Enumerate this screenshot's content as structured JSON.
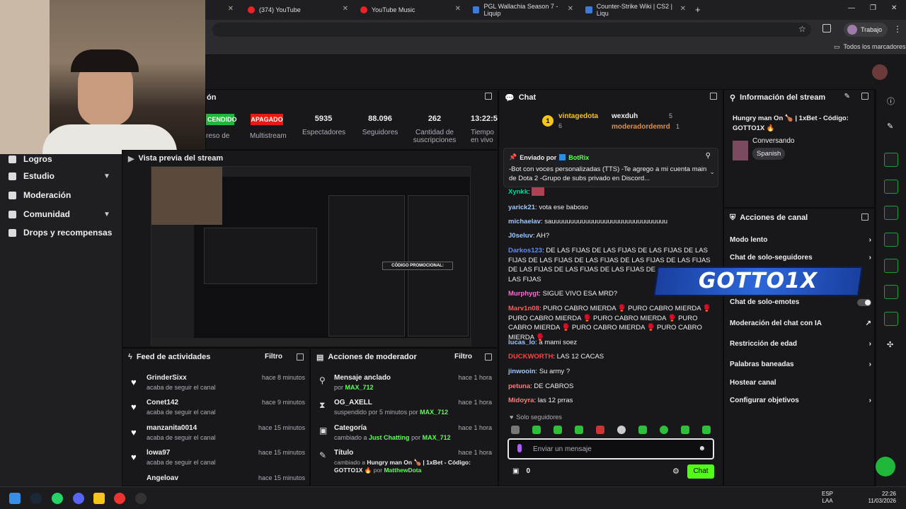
{
  "browser": {
    "tabs": [
      {
        "label": "(374) YouTube"
      },
      {
        "label": "YouTube Music"
      },
      {
        "label": "PGL Wallachia Season 7 - Liquip"
      },
      {
        "label": "Counter-Strike Wiki | CS2 | Liqu"
      }
    ],
    "profile_label": "Trabajo",
    "bookmarks_label": "Todos los marcadores"
  },
  "status": {
    "title_partial": "ón",
    "stats": [
      {
        "value": "CENDIDO",
        "label": "reso de"
      },
      {
        "value": "APAGADO",
        "label": "Multistream"
      },
      {
        "value": "5935",
        "label": "Espectadores"
      },
      {
        "value": "88.096",
        "label": "Seguidores"
      },
      {
        "value": "262",
        "label": "Cantidad de suscripciones"
      },
      {
        "value": "13:22:5",
        "label": "Tiempo en vivo"
      }
    ]
  },
  "sidebar": {
    "items": [
      {
        "label": "Logros"
      },
      {
        "label": "Estudio"
      },
      {
        "label": "Moderación"
      },
      {
        "label": "Comunidad"
      },
      {
        "label": "Drops y recompensas"
      }
    ]
  },
  "preview": {
    "title": "Vista previa del stream",
    "promo": "CÓDIGO PROMOCIONAL:"
  },
  "feed": {
    "title": "Feed de actividades",
    "filter": "Filtro",
    "items": [
      {
        "name": "GrinderSixx",
        "sub": "acaba de seguir el canal",
        "time": "hace 8 minutos"
      },
      {
        "name": "Conet142",
        "sub": "acaba de seguir el canal",
        "time": "hace 9 minutos"
      },
      {
        "name": "manzanita0014",
        "sub": "acaba de seguir el canal",
        "time": "hace 15 minutos"
      },
      {
        "name": "lowa97",
        "sub": "acaba de seguir el canal",
        "time": "hace 15 minutos"
      },
      {
        "name": "Angeloav",
        "sub": "",
        "time": "hace 15 minutos"
      }
    ]
  },
  "modactions": {
    "title": "Acciones de moderador",
    "filter": "Filtro",
    "items": [
      {
        "title": "Mensaje anclado",
        "pre": "por",
        "who": "MAX_712",
        "time": "hace 1 hora"
      },
      {
        "title": "OG_AXELL",
        "pre": "suspendido por 5 minutos por",
        "who": "MAX_712",
        "time": "hace 1 hora"
      },
      {
        "title": "Categoría",
        "pre": "cambiado a",
        "extra": "Just Chatting",
        "mid": "por",
        "who": "MAX_712",
        "time": "hace 1 hora"
      },
      {
        "title": "Título",
        "pre": "cambiado a",
        "extra": "Hungry man On 🍗 | 1xBet - Código: GOTTO1X 🔥",
        "mid": "por",
        "who": "MatthewDota",
        "time": "hace 1 hora"
      }
    ]
  },
  "chat": {
    "title": "Chat",
    "top": [
      {
        "rank": "1",
        "name": "vintagedota",
        "count": "6"
      },
      {
        "name": "wexduh",
        "count": "5"
      },
      {
        "name": "moderadordemrd",
        "count": "1"
      }
    ],
    "pinned": {
      "by_label": "Enviado por",
      "by": "BotRix",
      "text": "-Bot con voces personalizadas (TTS) -Te agrego a mi cuenta main de Dota 2 -Grupo de subs privado en Discord..."
    },
    "messages": [
      {
        "user": "Xynkk",
        "color": "#00d3a0",
        "text": ""
      },
      {
        "user": "yarick21",
        "color": "#9ec7ff",
        "text": "vota ese baboso"
      },
      {
        "user": "michaelav",
        "color": "#9ec7ff",
        "text": "sauuuuuuuuuuuuuuuuuuuuuuuuuuuuuuu"
      },
      {
        "user": "J0seluv",
        "color": "#9ec7ff",
        "text": "AH?"
      },
      {
        "user": "Darkos123",
        "color": "#5b8cff",
        "text": "DE LAS FIJAS DE LAS FIJAS DE LAS FIJAS DE LAS FIJAS DE LAS FIJAS DE LAS FIJAS DE LAS FIJAS DE LAS FIJAS DE LAS FIJAS DE LAS FIJAS DE LAS FIJAS DE LAS FIJAS DE LAS FIJAS"
      },
      {
        "user": "Murphygt",
        "color": "#ff6ad5",
        "text": "SIGUE VIVO ESA MRD?"
      },
      {
        "user": "Marv1n08",
        "color": "#ff5a5a",
        "text": "PURO CABRO MIERDA 🥊 PURO CABRO MIERDA 🥊 PURO CABRO MIERDA 🥊 PURO CABRO MIERDA 🥊 PURO CABRO MIERDA 🥊 PURO CABRO MIERDA 🥊 PURO CABRO MIERDA 🥊"
      },
      {
        "user": "lucas_lo",
        "color": "#9ec7ff",
        "text": "a mami soez"
      },
      {
        "user": "DUCKWORTH",
        "color": "#ff4040",
        "text": "LAS 12 CACAS"
      },
      {
        "user": "jinwooin",
        "color": "#9ec7ff",
        "text": "Su army ?"
      },
      {
        "user": "petuna",
        "color": "#ff7a7a",
        "text": "DE CABROS"
      },
      {
        "user": "Midoyra",
        "color": "#ff7a7a",
        "text": "las 12 prras"
      }
    ],
    "followers_only": "Solo seguidores",
    "input_placeholder": "Enviar un mensaje",
    "points": "0",
    "send_label": "Chat"
  },
  "info": {
    "title": "Información del stream",
    "stream_title": "Hungry man On 🍗 | 1xBet - Código: GOTTO1X 🔥",
    "category": "Conversando",
    "language": "Spanish"
  },
  "actions": {
    "title": "Acciones de canal",
    "items": [
      {
        "label": "Modo lento"
      },
      {
        "label": "Chat de solo-seguidores"
      },
      {
        "label": "Chat de solo-emotes"
      },
      {
        "label": "Moderación del chat con IA"
      },
      {
        "label": "Restricción de edad"
      },
      {
        "label": "Palabras baneadas"
      },
      {
        "label": "Hostear canal"
      },
      {
        "label": "Configurar objetivos"
      }
    ],
    "overlay_text": "GOTTO1X"
  },
  "taskbar": {
    "lang": "ESP",
    "lang2": "LAA",
    "time": "22:26",
    "date": "11/03/2026"
  },
  "colors": {
    "accent": "#53fc18",
    "panel": "#18181b",
    "bg": "#0e0e10"
  }
}
